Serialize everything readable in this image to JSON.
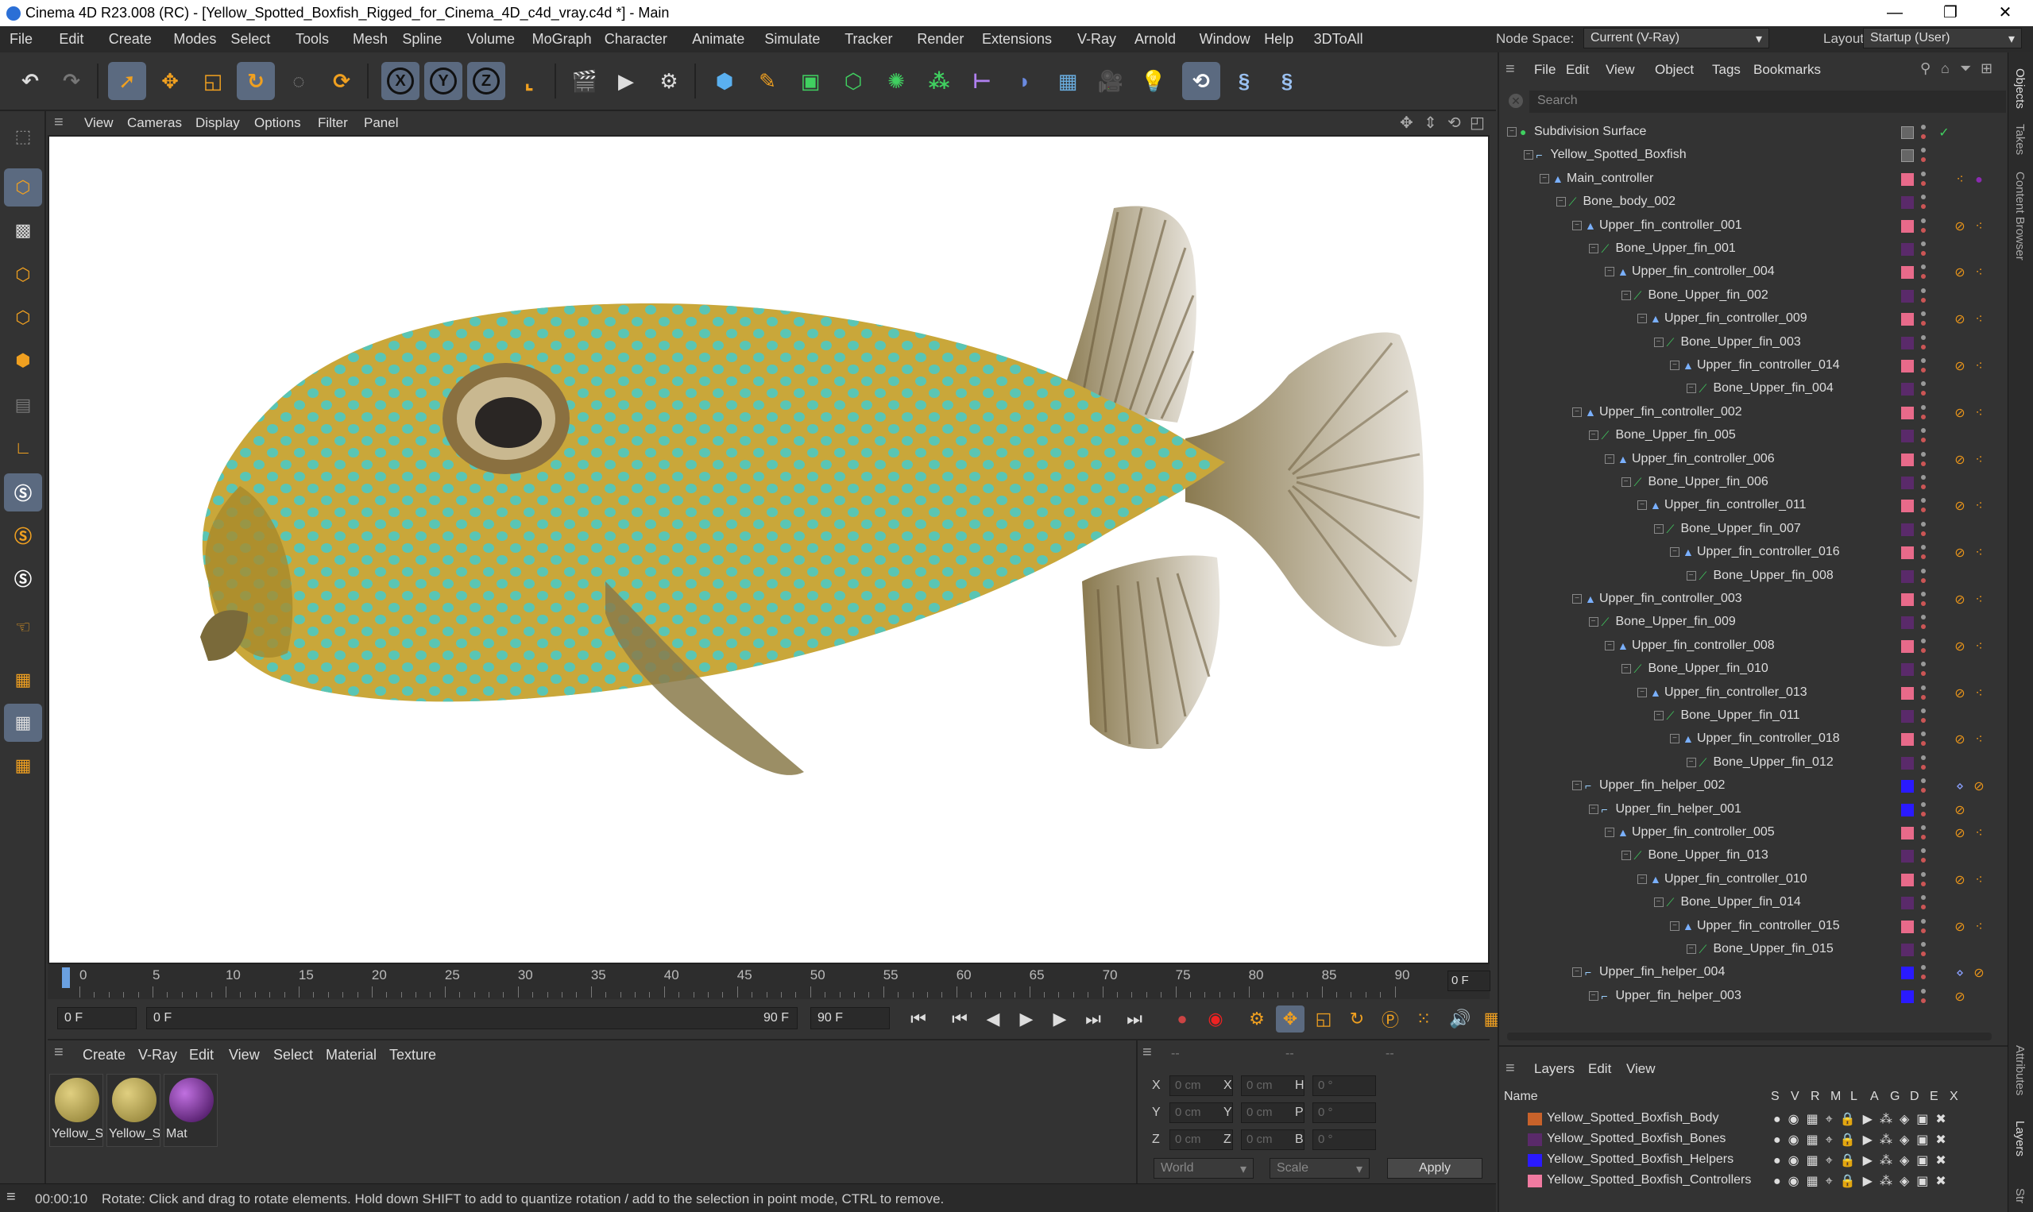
{
  "window": {
    "title": "Cinema 4D R23.008 (RC) - [Yellow_Spotted_Boxfish_Rigged_for_Cinema_4D_c4d_vray.c4d *] - Main",
    "controls": [
      "—",
      "❐",
      "✕"
    ]
  },
  "menubar": [
    "File",
    "Edit",
    "Create",
    "Modes",
    "Select",
    "Tools",
    "Mesh",
    "Spline",
    "Volume",
    "MoGraph",
    "Character",
    "Animate",
    "Simulate",
    "Tracker",
    "Render",
    "Extensions",
    "V-Ray",
    "Arnold",
    "Window",
    "Help",
    "3DToAll"
  ],
  "nodespace": {
    "label": "Node Space:",
    "value": "Current (V-Ray)",
    "layout_label": "Layout:",
    "layout_value": "Startup (User)"
  },
  "toolbar": {
    "axis_x": "X",
    "axis_y": "Y",
    "axis_z": "Z",
    "icons": [
      "undo-icon",
      "redo-icon",
      "select-icon",
      "move-icon",
      "scale-icon",
      "rotate-icon",
      "recent-tool-icon",
      "world-axis-icon",
      "render-view-icon",
      "render-icon",
      "render-settings-icon",
      "cube-icon",
      "pen-icon",
      "subdivision-icon",
      "extrude-icon",
      "cloner-icon",
      "deformer-icon",
      "field-icon",
      "scene-icon",
      "floor-icon",
      "camera-icon",
      "light-icon",
      "vray-icon",
      "python-icon",
      "python2-icon"
    ]
  },
  "viewport": {
    "menu": [
      "View",
      "Cameras",
      "Display",
      "Options",
      "Filter",
      "Panel"
    ]
  },
  "timeline": {
    "ticks": [
      "0",
      "5",
      "10",
      "15",
      "20",
      "25",
      "30",
      "35",
      "40",
      "45",
      "50",
      "55",
      "60",
      "65",
      "70",
      "75",
      "80",
      "85",
      "90"
    ],
    "current_frame": "0 F"
  },
  "transport": {
    "start": "0 F",
    "range_start": "0 F",
    "range_end": "90 F",
    "end": "90 F"
  },
  "materials": {
    "menu": [
      "Create",
      "V-Ray",
      "Edit",
      "View",
      "Select",
      "Material",
      "Texture"
    ],
    "items": [
      {
        "label": "Yellow_S",
        "color": "#b8a24a"
      },
      {
        "label": "Yellow_S",
        "color": "#b8a24a"
      },
      {
        "label": "Mat",
        "color": "#6b1f8a"
      }
    ]
  },
  "coords": {
    "rows": [
      {
        "a": "X",
        "av": "0 cm",
        "b": "X",
        "bv": "0 cm",
        "c": "H",
        "cv": "0 °"
      },
      {
        "a": "Y",
        "av": "0 cm",
        "b": "Y",
        "bv": "0 cm",
        "c": "P",
        "cv": "0 °"
      },
      {
        "a": "Z",
        "av": "0 cm",
        "b": "Z",
        "bv": "0 cm",
        "c": "B",
        "cv": "0 °"
      }
    ],
    "header": [
      "--",
      "--",
      "--"
    ],
    "space": "World",
    "mode": "Scale",
    "apply": "Apply"
  },
  "status": {
    "time": "00:00:10",
    "message": "Rotate: Click and drag to rotate elements. Hold down SHIFT to add to quantize rotation / add to the selection in point mode, CTRL to remove."
  },
  "objects": {
    "menu": [
      "File",
      "Edit",
      "View",
      "Object",
      "Tags",
      "Bookmarks"
    ],
    "search_placeholder": "Search",
    "rows": [
      {
        "name": "Subdivision Surface",
        "depth": 0,
        "type": "sds",
        "layer": "",
        "tags": "check"
      },
      {
        "name": "Yellow_Spotted_Boxfish",
        "depth": 1,
        "type": "null",
        "layer": "",
        "tags": ""
      },
      {
        "name": "Main_controller",
        "depth": 2,
        "type": "joint",
        "layer": "#e86a8a",
        "tags": "main"
      },
      {
        "name": "Bone_body_002",
        "depth": 3,
        "type": "bone",
        "layer": "#5a2a6a",
        "tags": ""
      },
      {
        "name": "Upper_fin_controller_001",
        "depth": 4,
        "type": "joint",
        "layer": "#e86a8a",
        "tags": "ik"
      },
      {
        "name": "Bone_Upper_fin_001",
        "depth": 5,
        "type": "bone",
        "layer": "#5a2a6a",
        "tags": ""
      },
      {
        "name": "Upper_fin_controller_004",
        "depth": 6,
        "type": "joint",
        "layer": "#e86a8a",
        "tags": "ik"
      },
      {
        "name": "Bone_Upper_fin_002",
        "depth": 7,
        "type": "bone",
        "layer": "#5a2a6a",
        "tags": ""
      },
      {
        "name": "Upper_fin_controller_009",
        "depth": 8,
        "type": "joint",
        "layer": "#e86a8a",
        "tags": "ik"
      },
      {
        "name": "Bone_Upper_fin_003",
        "depth": 9,
        "type": "bone",
        "layer": "#5a2a6a",
        "tags": ""
      },
      {
        "name": "Upper_fin_controller_014",
        "depth": 10,
        "type": "joint",
        "layer": "#e86a8a",
        "tags": "ik"
      },
      {
        "name": "Bone_Upper_fin_004",
        "depth": 11,
        "type": "bone",
        "layer": "#5a2a6a",
        "tags": ""
      },
      {
        "name": "Upper_fin_controller_002",
        "depth": 4,
        "type": "joint",
        "layer": "#e86a8a",
        "tags": "ik"
      },
      {
        "name": "Bone_Upper_fin_005",
        "depth": 5,
        "type": "bone",
        "layer": "#5a2a6a",
        "tags": ""
      },
      {
        "name": "Upper_fin_controller_006",
        "depth": 6,
        "type": "joint",
        "layer": "#e86a8a",
        "tags": "ik"
      },
      {
        "name": "Bone_Upper_fin_006",
        "depth": 7,
        "type": "bone",
        "layer": "#5a2a6a",
        "tags": ""
      },
      {
        "name": "Upper_fin_controller_011",
        "depth": 8,
        "type": "joint",
        "layer": "#e86a8a",
        "tags": "ik"
      },
      {
        "name": "Bone_Upper_fin_007",
        "depth": 9,
        "type": "bone",
        "layer": "#5a2a6a",
        "tags": ""
      },
      {
        "name": "Upper_fin_controller_016",
        "depth": 10,
        "type": "joint",
        "layer": "#e86a8a",
        "tags": "ik"
      },
      {
        "name": "Bone_Upper_fin_008",
        "depth": 11,
        "type": "bone",
        "layer": "#5a2a6a",
        "tags": ""
      },
      {
        "name": "Upper_fin_controller_003",
        "depth": 4,
        "type": "joint",
        "layer": "#e86a8a",
        "tags": "ik"
      },
      {
        "name": "Bone_Upper_fin_009",
        "depth": 5,
        "type": "bone",
        "layer": "#5a2a6a",
        "tags": ""
      },
      {
        "name": "Upper_fin_controller_008",
        "depth": 6,
        "type": "joint",
        "layer": "#e86a8a",
        "tags": "ik"
      },
      {
        "name": "Bone_Upper_fin_010",
        "depth": 7,
        "type": "bone",
        "layer": "#5a2a6a",
        "tags": ""
      },
      {
        "name": "Upper_fin_controller_013",
        "depth": 8,
        "type": "joint",
        "layer": "#e86a8a",
        "tags": "ik"
      },
      {
        "name": "Bone_Upper_fin_011",
        "depth": 9,
        "type": "bone",
        "layer": "#5a2a6a",
        "tags": ""
      },
      {
        "name": "Upper_fin_controller_018",
        "depth": 10,
        "type": "joint",
        "layer": "#e86a8a",
        "tags": "ik"
      },
      {
        "name": "Bone_Upper_fin_012",
        "depth": 11,
        "type": "bone",
        "layer": "#5a2a6a",
        "tags": ""
      },
      {
        "name": "Upper_fin_helper_002",
        "depth": 4,
        "type": "null",
        "layer": "#2a1aff",
        "tags": "helper"
      },
      {
        "name": "Upper_fin_helper_001",
        "depth": 5,
        "type": "null",
        "layer": "#2a1aff",
        "tags": "x"
      },
      {
        "name": "Upper_fin_controller_005",
        "depth": 6,
        "type": "joint",
        "layer": "#e86a8a",
        "tags": "ik"
      },
      {
        "name": "Bone_Upper_fin_013",
        "depth": 7,
        "type": "bone",
        "layer": "#5a2a6a",
        "tags": ""
      },
      {
        "name": "Upper_fin_controller_010",
        "depth": 8,
        "type": "joint",
        "layer": "#e86a8a",
        "tags": "ik"
      },
      {
        "name": "Bone_Upper_fin_014",
        "depth": 9,
        "type": "bone",
        "layer": "#5a2a6a",
        "tags": ""
      },
      {
        "name": "Upper_fin_controller_015",
        "depth": 10,
        "type": "joint",
        "layer": "#e86a8a",
        "tags": "ik"
      },
      {
        "name": "Bone_Upper_fin_015",
        "depth": 11,
        "type": "bone",
        "layer": "#5a2a6a",
        "tags": ""
      },
      {
        "name": "Upper_fin_helper_004",
        "depth": 4,
        "type": "null",
        "layer": "#2a1aff",
        "tags": "helper"
      },
      {
        "name": "Upper_fin_helper_003",
        "depth": 5,
        "type": "null",
        "layer": "#2a1aff",
        "tags": "x"
      }
    ]
  },
  "layers": {
    "menu": [
      "Layers",
      "Edit",
      "View"
    ],
    "header_name": "Name",
    "flags_header": [
      "S",
      "V",
      "R",
      "M",
      "L",
      "A",
      "G",
      "D",
      "E",
      "X"
    ],
    "rows": [
      {
        "name": "Yellow_Spotted_Boxfish_Body",
        "color": "#c8622a"
      },
      {
        "name": "Yellow_Spotted_Boxfish_Bones",
        "color": "#5a2a6a"
      },
      {
        "name": "Yellow_Spotted_Boxfish_Helpers",
        "color": "#2a1aff"
      },
      {
        "name": "Yellow_Spotted_Boxfish_Controllers",
        "color": "#f07aa0"
      }
    ]
  },
  "side_tabs": [
    "Objects",
    "Takes",
    "Content Browser",
    "Attributes",
    "Layers",
    "Str"
  ]
}
